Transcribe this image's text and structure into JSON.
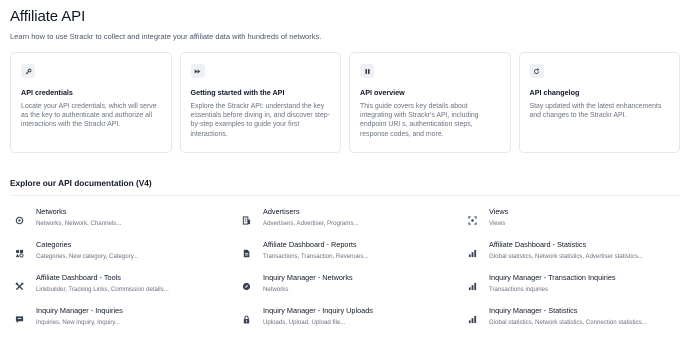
{
  "page": {
    "title": "Affiliate API",
    "subtitle": "Learn how to use Strackr to collect and integrate your affiliate data with hundreds of networks."
  },
  "cards": [
    {
      "icon": "key-icon",
      "title": "API credentials",
      "desc": "Locate your API credentials, which will serve as the key to authenticate and authorize all interactions with the Strackr API."
    },
    {
      "icon": "fast-forward-icon",
      "title": "Getting started with the API",
      "desc": "Explore the Strackr API: understand the key essentials before diving in, and discover step-by-step examples to guide your first interactions."
    },
    {
      "icon": "pause-bars-icon",
      "title": "API overview",
      "desc": "This guide covers key details about integrating with Strackr's API, including endpoint URI s, authentication steps, response codes, and more."
    },
    {
      "icon": "refresh-icon",
      "title": "API changelog",
      "desc": "Stay updated with the latest enhancements and changes to the Strackr API."
    }
  ],
  "docs": {
    "section_title": "Explore our API documentation (V4)",
    "items": [
      {
        "icon": "networks-icon",
        "title": "Networks",
        "sub": "Networks, Network, Channels..."
      },
      {
        "icon": "advertisers-icon",
        "title": "Advertisers",
        "sub": "Advertisers, Advertiser, Programs..."
      },
      {
        "icon": "views-icon",
        "title": "Views",
        "sub": "Views"
      },
      {
        "icon": "categories-icon",
        "title": "Categories",
        "sub": "Categories, New category, Category..."
      },
      {
        "icon": "document-icon",
        "title": "Affiliate Dashboard - Reports",
        "sub": "Transactions, Transaction, Revenues..."
      },
      {
        "icon": "bar-chart-icon",
        "title": "Affiliate Dashboard - Statistics",
        "sub": "Global statistics, Network statistics, Advertiser statistics..."
      },
      {
        "icon": "tools-icon",
        "title": "Affiliate Dashboard - Tools",
        "sub": "Linkbuilder, Tracking Links, Commission details..."
      },
      {
        "icon": "compass-icon",
        "title": "Inquiry Manager - Networks",
        "sub": "Networks"
      },
      {
        "icon": "bar-chart-icon",
        "title": "Inquiry Manager - Transaction Inquiries",
        "sub": "Transactions inquiries"
      },
      {
        "icon": "chat-icon",
        "title": "Inquiry Manager - Inquiries",
        "sub": "Inquiries, New inquiry, Inquiry..."
      },
      {
        "icon": "upload-lock-icon",
        "title": "Inquiry Manager - Inquiry Uploads",
        "sub": "Uploads, Upload, Upload file..."
      },
      {
        "icon": "bar-chart-icon",
        "title": "Inquiry Manager - Statistics",
        "sub": "Global statistics, Network statistics, Connection statistics..."
      }
    ]
  },
  "colors": {
    "icon": "#374151",
    "text": "#111827",
    "muted": "#6b7280",
    "border": "#e5e7eb"
  }
}
